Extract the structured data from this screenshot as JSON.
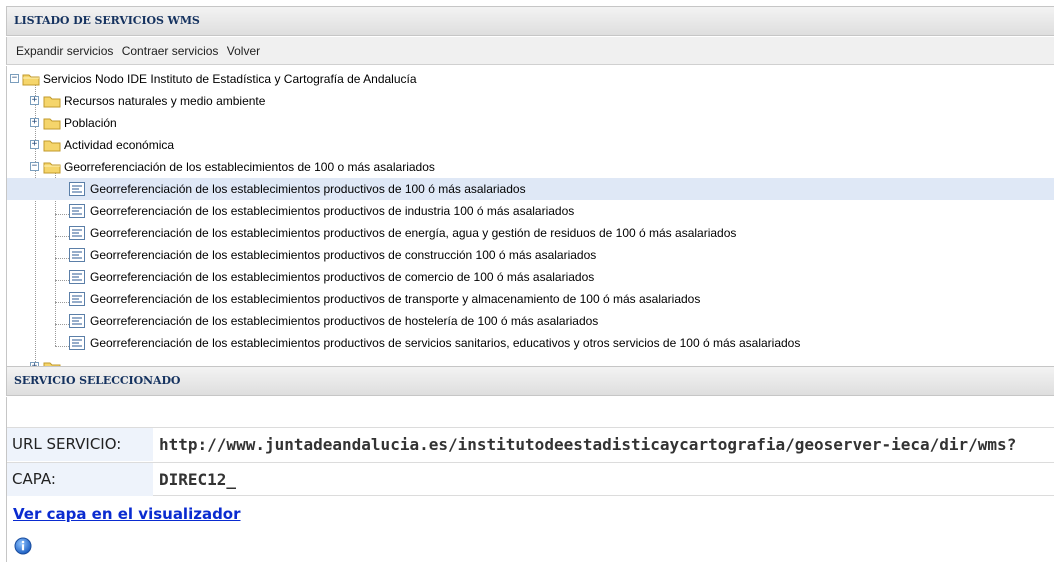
{
  "list_panel": {
    "title": "LISTADO DE SERVICIOS WMS"
  },
  "toolbar": {
    "expand_label": "Expandir servicios",
    "collapse_label": "Contraer servicios",
    "back_label": "Volver"
  },
  "tree": {
    "root": {
      "label": "Servicios Nodo IDE Instituto de Estadística y Cartografía de Andalucía",
      "expanded": true
    },
    "groups": [
      {
        "label": "Recursos naturales y medio ambiente",
        "expanded": false
      },
      {
        "label": "Población",
        "expanded": false
      },
      {
        "label": "Actividad económica",
        "expanded": false
      },
      {
        "label": "Georreferenciación de los establecimientos de 100 o más asalariados",
        "expanded": true
      }
    ],
    "layers": [
      {
        "label": "Georreferenciación de los establecimientos productivos de 100 ó más asalariados",
        "selected": true
      },
      {
        "label": "Georreferenciación de los establecimientos productivos de industria 100 ó más asalariados",
        "selected": false
      },
      {
        "label": "Georreferenciación de los establecimientos productivos de energía, agua y gestión de residuos de 100 ó más asalariados",
        "selected": false
      },
      {
        "label": "Georreferenciación de los establecimientos productivos de construcción 100 ó más asalariados",
        "selected": false
      },
      {
        "label": "Georreferenciación de los establecimientos productivos de comercio de 100 ó más asalariados",
        "selected": false
      },
      {
        "label": "Georreferenciación de los establecimientos productivos de transporte y almacenamiento de 100 ó más asalariados",
        "selected": false
      },
      {
        "label": "Georreferenciación de los establecimientos productivos de hostelería de 100 ó más asalariados",
        "selected": false
      },
      {
        "label": "Georreferenciación de los establecimientos productivos de servicios sanitarios, educativos y otros servicios de 100 ó más asalariados",
        "selected": false
      }
    ]
  },
  "selected_panel": {
    "title": "SERVICIO SELECCIONADO",
    "url_label": "URL SERVICIO:",
    "url_value": "http://www.juntadeandalucia.es/institutodeestadisticaycartografia/geoserver-ieca/dir/wms?",
    "layer_label": "CAPA:",
    "layer_value": "DIREC12_",
    "viewer_link": "Ver capa en el visualizador"
  },
  "icons": {
    "folder": "folder-icon",
    "layer": "layer-icon",
    "info": "info-icon",
    "expand": "plus-icon",
    "collapse": "minus-icon"
  },
  "colors": {
    "header_text": "#15325f",
    "selected_row": "#dfe8f6",
    "link": "#0a2bd0",
    "key_cell_bg": "#eef3fb"
  }
}
